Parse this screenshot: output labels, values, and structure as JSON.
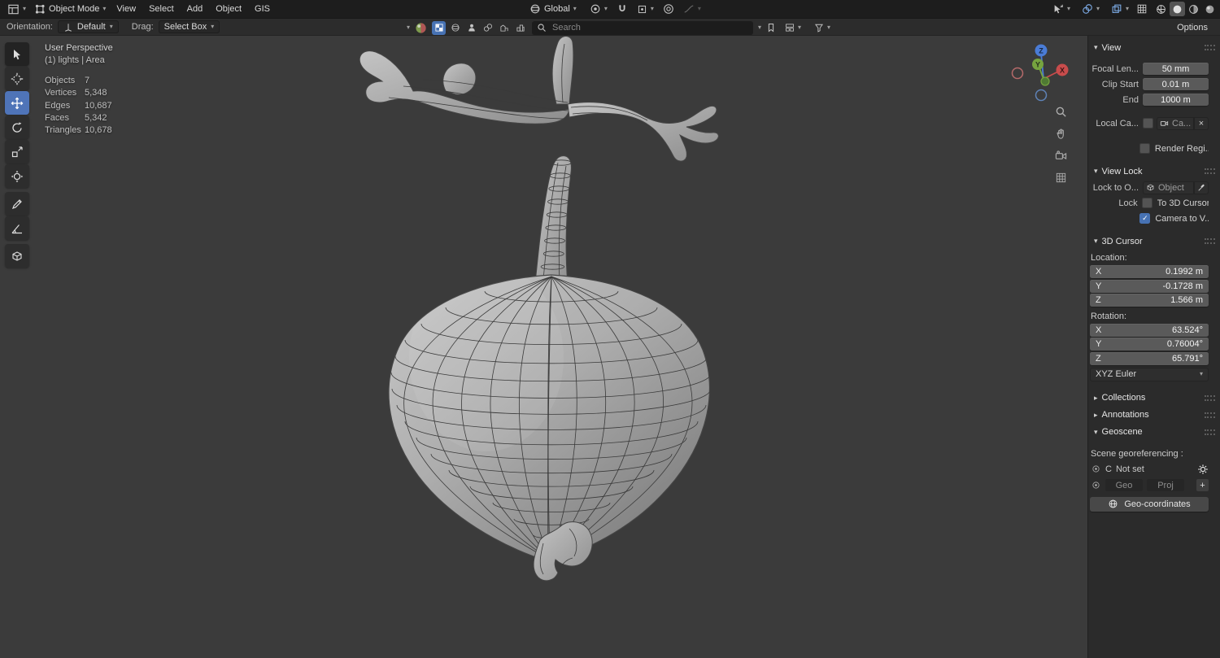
{
  "icons": {
    "caret_down": "▾",
    "caret_right": "▸",
    "check": "✓",
    "close": "×",
    "plus": "+"
  },
  "topbar": {
    "mode": "Object Mode",
    "menus": [
      "View",
      "Select",
      "Add",
      "Object",
      "GIS"
    ],
    "transform_orientation": "Global"
  },
  "toolrow": {
    "orientation_label": "Orientation:",
    "orientation_value": "Default",
    "drag_label": "Drag:",
    "drag_value": "Select Box",
    "search_placeholder": "Search",
    "options_label": "Options"
  },
  "viewport": {
    "projection_label": "User Perspective",
    "scene_label": "(1) lights | Area",
    "stats": [
      {
        "label": "Objects",
        "value": "7"
      },
      {
        "label": "Vertices",
        "value": "5,348"
      },
      {
        "label": "Edges",
        "value": "10,687"
      },
      {
        "label": "Faces",
        "value": "5,342"
      },
      {
        "label": "Triangles",
        "value": "10,678"
      }
    ],
    "axis_labels": {
      "x": "X",
      "y": "Y",
      "z": "Z"
    },
    "colors": {
      "axis_x": "#c84c4c",
      "axis_y": "#76a43f",
      "axis_z": "#4a7cd6",
      "background": "#3b3b3b",
      "accent": "#4772b3"
    }
  },
  "sidebar": {
    "view": {
      "title": "View",
      "focal_label": "Focal Len...",
      "focal_value": "50 mm",
      "clip_start_label": "Clip Start",
      "clip_start_value": "0.01 m",
      "clip_end_label": "End",
      "clip_end_value": "1000 m",
      "local_camera_label": "Local Ca...",
      "local_camera_value": "Ca...",
      "render_region_label": "Render Regi..."
    },
    "view_lock": {
      "title": "View Lock",
      "lock_object_label": "Lock to O...",
      "lock_object_value": "Object",
      "lock_label": "Lock",
      "to_3d_cursor_label": "To 3D Cursor",
      "camera_to_view_label": "Camera to V..."
    },
    "cursor3d": {
      "title": "3D Cursor",
      "location_label": "Location:",
      "location": [
        {
          "axis": "X",
          "value": "0.1992 m"
        },
        {
          "axis": "Y",
          "value": "-0.1728 m"
        },
        {
          "axis": "Z",
          "value": "1.566 m"
        }
      ],
      "rotation_label": "Rotation:",
      "rotation": [
        {
          "axis": "X",
          "value": "63.524°"
        },
        {
          "axis": "Y",
          "value": "0.76004°"
        },
        {
          "axis": "Z",
          "value": "65.791°"
        }
      ],
      "rotation_mode": "XYZ Euler"
    },
    "collections_title": "Collections",
    "annotations_title": "Annotations",
    "geoscene": {
      "title": "Geoscene",
      "georeferencing_label": "Scene georeferencing :",
      "crs_prefix": "C",
      "crs_value": "Not set",
      "geo_label": "Geo",
      "proj_label": "Proj",
      "add_label": "+",
      "geocoordinates_label": "Geo-coordinates"
    }
  }
}
